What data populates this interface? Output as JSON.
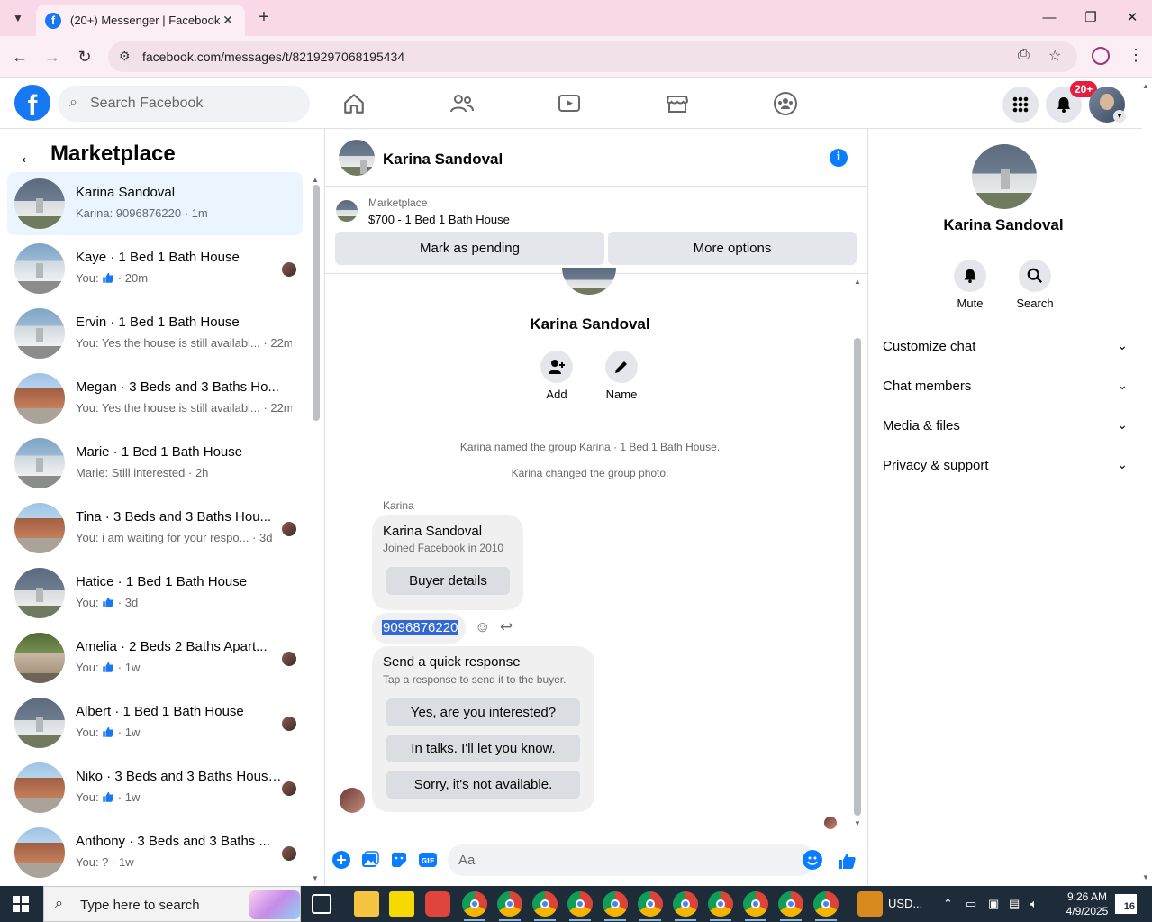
{
  "browser": {
    "tab_title": "(20+) Messenger | Facebook",
    "url": "facebook.com/messages/t/8219297068195434",
    "new_tab_symbol": "+",
    "close_symbol": "✕",
    "minimize_symbol": "—",
    "restore_symbol": "❐"
  },
  "fb": {
    "search_placeholder": "Search Facebook",
    "notifications_badge": "20+"
  },
  "left": {
    "title": "Marketplace",
    "conversations": [
      {
        "name": "Karina Sandoval",
        "preview": "Karina: 9096876220",
        "time": "1m",
        "thumb": "gray",
        "active": true,
        "like": false
      },
      {
        "name": "Kaye · 1 Bed 1 Bath House",
        "preview": "You:",
        "time": "20m",
        "thumb": "blue",
        "like": true
      },
      {
        "name": "Ervin · 1 Bed 1 Bath House",
        "preview": "You: Yes the house is still availabl...",
        "time": "22m",
        "thumb": "blue",
        "like": false
      },
      {
        "name": "Megan · 3 Beds and 3 Baths Ho...",
        "preview": "You: Yes the house is still availabl...",
        "time": "22m",
        "thumb": "brick",
        "like": false
      },
      {
        "name": "Marie · 1 Bed 1 Bath House",
        "preview": "Marie: Still interested",
        "time": "2h",
        "thumb": "blue",
        "like": false
      },
      {
        "name": "Tina · 3 Beds and 3 Baths Hou...",
        "preview": "You: i am waiting for your respo...",
        "time": "3d",
        "thumb": "brick",
        "like": false
      },
      {
        "name": "Hatice · 1 Bed 1 Bath House",
        "preview": "You:",
        "time": "3d",
        "thumb": "gray",
        "like": true
      },
      {
        "name": "Amelia · 2 Beds 2 Baths Apart...",
        "preview": "You:",
        "time": "1w",
        "thumb": "tree",
        "like": true
      },
      {
        "name": "Albert · 1 Bed 1 Bath House",
        "preview": "You:",
        "time": "1w",
        "thumb": "gray",
        "like": true
      },
      {
        "name": "Niko · 3 Beds and 3 Baths House...",
        "preview": "You:",
        "time": "1w",
        "thumb": "brick",
        "like": true
      },
      {
        "name": "Anthony · 3 Beds and 3 Baths ...",
        "preview": "You: ?",
        "time": "1w",
        "thumb": "brick",
        "like": false
      }
    ]
  },
  "chat": {
    "contact_name": "Karina Sandoval",
    "listing_label": "Marketplace",
    "listing_title": "$700 - 1 Bed 1 Bath House",
    "mark_pending": "Mark as pending",
    "more_options": "More options",
    "group_name": "Karina Sandoval",
    "add_label": "Add",
    "name_label": "Name",
    "system_1": "Karina named the group Karina · 1 Bed 1 Bath House.",
    "system_2": "Karina changed the group photo.",
    "sender_label": "Karina",
    "card_name": "Karina Sandoval",
    "card_joined": "Joined Facebook in 2010",
    "buyer_details": "Buyer details",
    "phone_message": "9096876220",
    "quick_title": "Send a quick response",
    "quick_sub": "Tap a response to send it to the buyer.",
    "quick_1": "Yes, are you interested?",
    "quick_2": "In talks. I'll let you know.",
    "quick_3": "Sorry, it's not available.",
    "composer_placeholder": "Aa"
  },
  "right": {
    "name": "Karina Sandoval",
    "mute": "Mute",
    "search": "Search",
    "sections": [
      "Customize chat",
      "Chat members",
      "Media & files",
      "Privacy & support"
    ]
  },
  "taskbar": {
    "search_placeholder": "Type here to search",
    "tray_text": "USD...",
    "time": "9:26 AM",
    "date": "4/9/2025",
    "notification_count": "16"
  },
  "colors": {
    "fb_blue": "#1877f2",
    "messenger_blue": "#0a7cff",
    "active_bg": "#ebf5ff",
    "tab_strip": "#f9d9e8"
  }
}
